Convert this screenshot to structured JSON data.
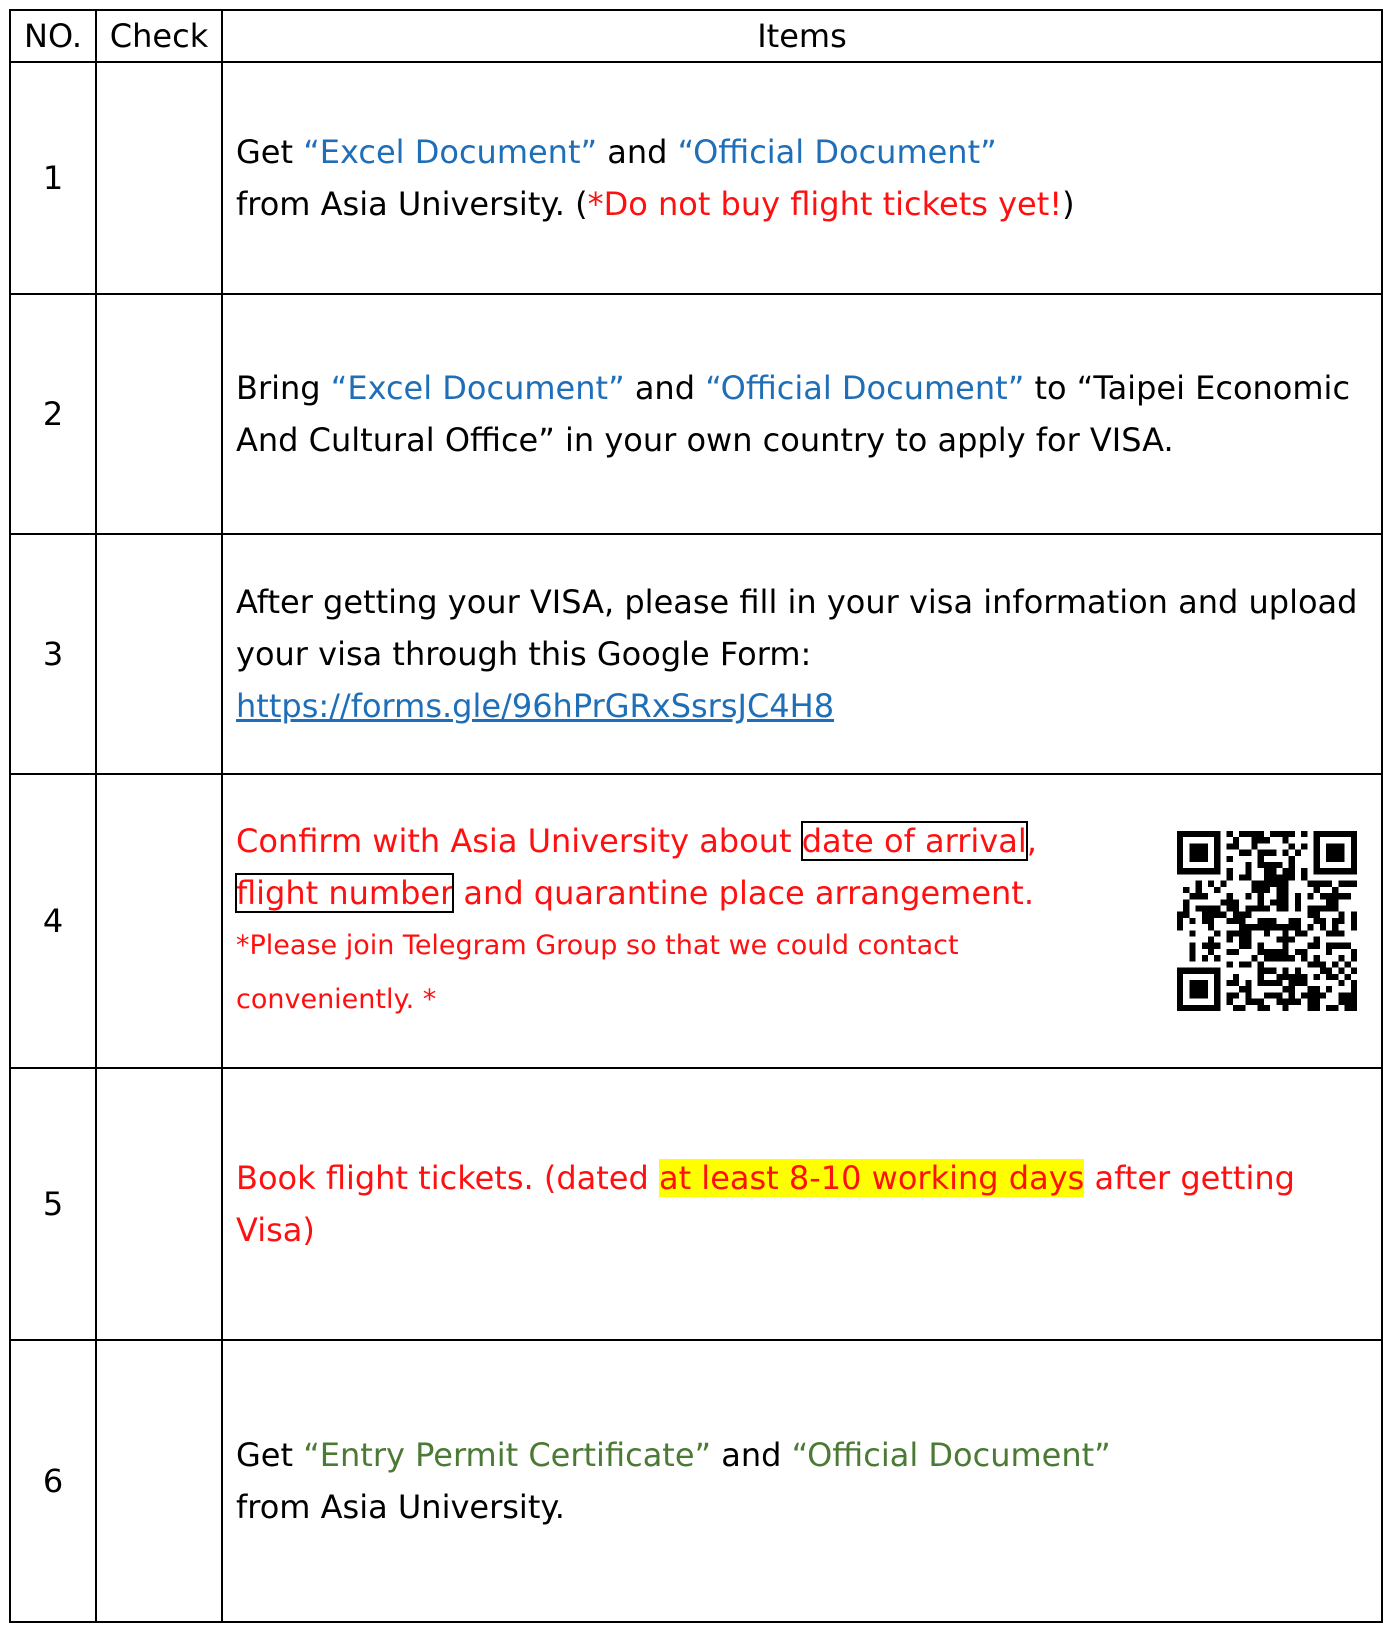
{
  "headers": {
    "no": "NO.",
    "check": "Check",
    "items": "Items"
  },
  "rows": [
    {
      "no": "1",
      "l1": [
        "Get ",
        "“Excel Document”",
        " and ",
        "“Official Document”"
      ],
      "l2": [
        "from Asia University. (",
        "*Do not buy flight tickets yet!",
        ")"
      ]
    },
    {
      "no": "2",
      "p": [
        "Bring ",
        "“Excel Document”",
        " and ",
        "“Official Document”",
        " to “Taipei Economic And Cultural Office” in your own country to apply for VISA."
      ]
    },
    {
      "no": "3",
      "text": "After getting your VISA, please fill in your visa information and upload your visa through this Google Form:",
      "link": "https://forms.gle/96hPrGRxSsrsJC4H8"
    },
    {
      "no": "4",
      "l1": [
        "Confirm with Asia University about ",
        "date of arrival",
        ","
      ],
      "l2": [
        "flight number",
        " and quarantine place arrangement."
      ],
      "note": "*Please join Telegram Group so that we could contact conveniently. *"
    },
    {
      "no": "5",
      "p": [
        "Book flight tickets. (dated ",
        "at least 8-10 working days",
        " after getting Visa)"
      ]
    },
    {
      "no": "6",
      "l1": [
        "Get ",
        "“Entry Permit Certificate”",
        " and ",
        "“Official Document”"
      ],
      "l2": "from Asia University."
    }
  ]
}
